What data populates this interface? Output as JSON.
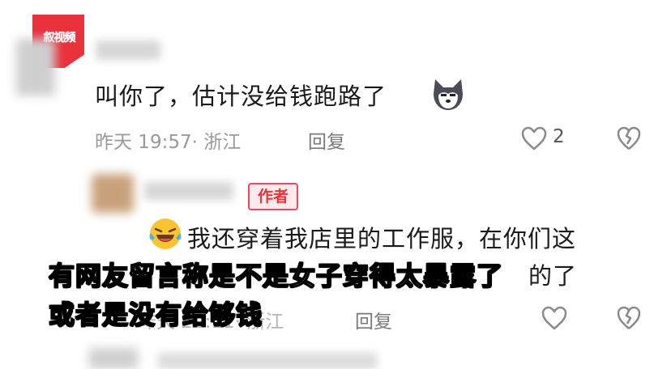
{
  "watermark": {
    "logo_text": "叙视频"
  },
  "comments": [
    {
      "text": "叫你了，估计没给钱跑路了",
      "emoji": "husky-emoji",
      "time_location": "昨天 19:57· 浙江",
      "reply_label": "回复",
      "like_count": "2"
    },
    {
      "badge": "作者",
      "emoji": "laughing-tears-emoji",
      "text": "我还穿着我店里的工作服，在你们这",
      "text_line2_partial": "的了",
      "time_location_partial": "昨天 20:11· 浙江",
      "reply_label": "回复"
    }
  ],
  "subtitle": {
    "line1": "有网友留言称是不是女子穿得太暴露了",
    "line2": "或者是没有给够钱"
  },
  "colors": {
    "accent": "#e8323c",
    "meta_gray": "#9a9a9a",
    "text": "#1a1a1a"
  }
}
